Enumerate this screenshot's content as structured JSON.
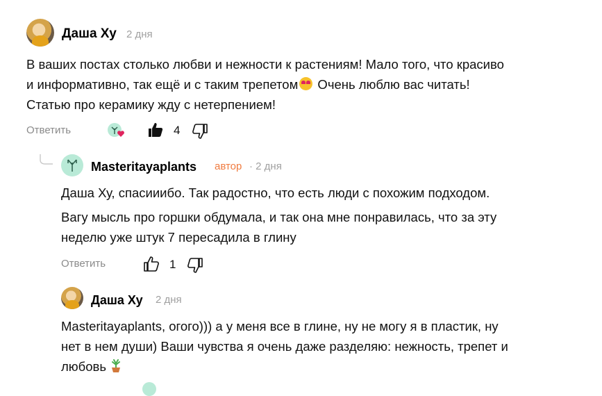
{
  "comment1": {
    "author": "Даша Ху",
    "time": "2 дня",
    "text_line1": "В ваших постах столько любви и нежности к растениям! Мало того, что красиво",
    "text_line2_a": "и информативно, так ещё и с таким трепетом",
    "text_line2_b": " Очень люблю вас читать!",
    "text_line3": "Статью про керамику жду с нетерпением!",
    "reply_label": "Ответить",
    "likes": "4"
  },
  "comment2": {
    "author": "Masteritayaplants",
    "author_badge": "автор",
    "time": "· 2 дня",
    "para1": "Даша Ху, спасииибо. Так радостно, что есть люди с похожим подходом.",
    "para2_line1": "Вагу мысль про горшки обдумала, и так она мне понравилась, что за эту",
    "para2_line2": "неделю уже штук 7 пересадила в глину",
    "reply_label": "Ответить",
    "likes": "1"
  },
  "comment3": {
    "author": "Даша Ху",
    "time": "2 дня",
    "line1": "Masteritayaplants, огого))) а у меня все в глине, ну не могу я в пластик, ну",
    "line2": "нет в нем души) Ваши чувства я очень даже разделяю: нежность, трепет и",
    "line3": "любовь"
  },
  "icons": {
    "avatar_user": "user-avatar",
    "avatar_author": "plant-logo-avatar",
    "reaction": "plant-heart-icon",
    "like": "thumbs-up-icon",
    "dislike": "thumbs-down-icon",
    "heart_eyes": "heart-eyes-emoji",
    "sprout": "potted-plant-emoji",
    "thread_line": "reply-thread-curve-icon"
  },
  "colors": {
    "author_badge": "#f07b3f",
    "muted": "#8a8a8a",
    "plant_avatar_bg": "#b9ead7"
  }
}
